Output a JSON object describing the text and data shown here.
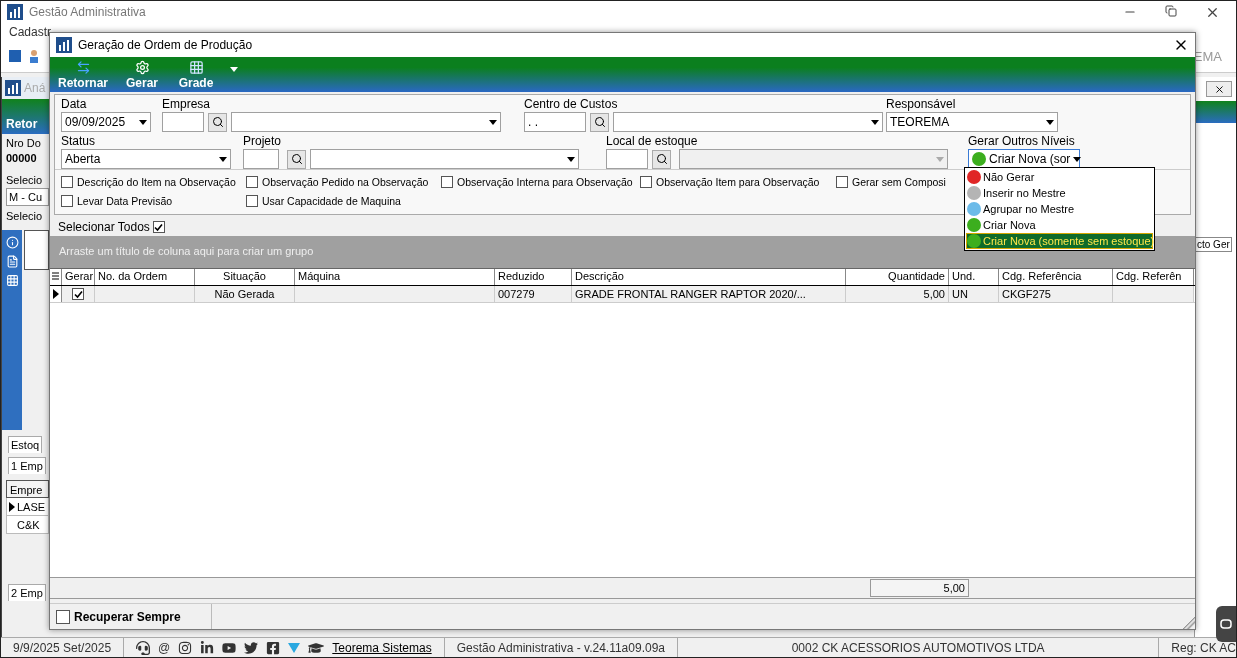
{
  "app": {
    "title": "Gestão Administrativa",
    "menu": [
      "Cadastr"
    ],
    "toolbar_text": "EMA"
  },
  "background_window": {
    "title": "Aná",
    "button": "Retor",
    "label_1": "Nro Do",
    "value_1": "00000",
    "label_2": "Selecio",
    "combo": "M - Cu",
    "label_3": "Selecio",
    "tab": "Estoq",
    "subtab": "1 Emp",
    "grid_header": "Empre",
    "grid_rows": [
      {
        "text": "LASE",
        "selected": true
      },
      {
        "text": "C&K",
        "selected": false
      }
    ],
    "bottom_tab": "2 Emp",
    "right_column": "cto Ger"
  },
  "dialog": {
    "title": "Geração de Ordem de Produção",
    "toolbar": [
      {
        "label": "Retornar",
        "kind": "back"
      },
      {
        "label": "Gerar",
        "kind": "gear"
      },
      {
        "label": "Grade",
        "kind": "grid"
      }
    ],
    "fields": {
      "data": {
        "label": "Data",
        "value": "09/09/2025"
      },
      "empresa": {
        "label": "Empresa"
      },
      "centro": {
        "label": "Centro de Custos",
        "value": ". ."
      },
      "responsavel": {
        "label": "Responsável",
        "value": "TEOREMA"
      },
      "status": {
        "label": "Status",
        "value": "Aberta"
      },
      "projeto": {
        "label": "Projeto"
      },
      "local": {
        "label": "Local de estoque",
        "disabled": true
      },
      "niveis": {
        "label": "Gerar Outros Níveis",
        "value": "Criar Nova (sor",
        "color": "#3cae1e"
      }
    },
    "options": [
      [
        {
          "label": "Descrição do Item na Observação",
          "checked": false
        },
        {
          "label": "Observação Pedido na Observação",
          "checked": false
        },
        {
          "label": "Observação Interna para Observação",
          "checked": false
        },
        {
          "label": "Observação Item para Observação",
          "checked": false
        },
        {
          "label": "Gerar sem Composi",
          "checked": false
        }
      ],
      [
        {
          "label": "Levar Data Previsão",
          "checked": false
        },
        {
          "label": "Usar Capacidade de Maquina",
          "checked": false
        }
      ]
    ],
    "select_all": {
      "label": "Selecionar Todos",
      "checked": true
    },
    "group_hint": "Arraste um título de coluna aqui para criar um grupo",
    "table": {
      "columns": [
        {
          "label": "Gerar",
          "kind": "check"
        },
        {
          "label": "No. da Ordem",
          "kind": "text"
        },
        {
          "label": "Situação",
          "kind": "text"
        },
        {
          "label": "Máquina",
          "kind": "text"
        },
        {
          "label": "Reduzido",
          "kind": "text"
        },
        {
          "label": "Descrição",
          "kind": "text"
        },
        {
          "label": "Quantidade",
          "kind": "text"
        },
        {
          "label": "Und.",
          "kind": "text"
        },
        {
          "label": "Cdg. Referência",
          "kind": "text"
        },
        {
          "label": "Cdg. Referên",
          "kind": "text"
        }
      ],
      "rows": [
        {
          "selected": true,
          "gerar": true,
          "situacao": "Não Gerada",
          "reduzido": "007279",
          "descricao": "GRADE FRONTAL RANGER RAPTOR 2020/...",
          "quantidade": "5,00",
          "und": "UN",
          "ref": "CKGF275"
        }
      ],
      "total": "5,00"
    },
    "recuperar": {
      "label": "Recuperar Sempre",
      "checked": false
    },
    "dropdown": [
      {
        "label": "Não Gerar",
        "color": "#e02626",
        "selected": false
      },
      {
        "label": "Inserir no Mestre",
        "color": "#b4b4b4",
        "selected": false
      },
      {
        "label": "Agrupar no Mestre",
        "color": "#6cbbe9",
        "selected": false
      },
      {
        "label": "Criar Nova",
        "color": "#3cae1e",
        "selected": false
      },
      {
        "label": "Criar Nova (somente sem estoque)",
        "color": "#3cae1e",
        "selected": true
      }
    ]
  },
  "status_bar": {
    "date": "9/9/2025 Set/2025",
    "at": "@",
    "link": "Teorema Sistemas",
    "version": "Gestão Administrativa - v.24.11a09.09a",
    "company": "0002 CK ACESSORIOS AUTOMOTIVOS LTDA",
    "reg": "Reg: CK AC"
  }
}
